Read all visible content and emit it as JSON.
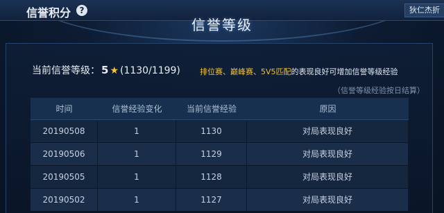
{
  "header": {
    "title": "信誉积分",
    "help_icon": "?",
    "user_tag": "狄仁杰折"
  },
  "page_title": "信誉等级",
  "level": {
    "label": "当前信誉等级：",
    "value": "5",
    "star_icon": "star-icon",
    "progress": "(1130/1199)"
  },
  "tip": {
    "highlight": "排位赛、巅峰赛、5V5匹配",
    "rest": "的表现良好可增加信誉等级经验"
  },
  "note": "（信誉等级经验按日结算）",
  "table": {
    "headers": [
      "时间",
      "信誉经验变化",
      "当前信誉经验",
      "原因"
    ],
    "rows": [
      [
        "20190508",
        "1",
        "1130",
        "对局表现良好"
      ],
      [
        "20190506",
        "1",
        "1129",
        "对局表现良好"
      ],
      [
        "20190505",
        "1",
        "1128",
        "对局表现良好"
      ],
      [
        "20190502",
        "1",
        "1127",
        "对局表现良好"
      ]
    ]
  },
  "colors": {
    "accent": "#f0c23a",
    "background": "#0a1628"
  }
}
